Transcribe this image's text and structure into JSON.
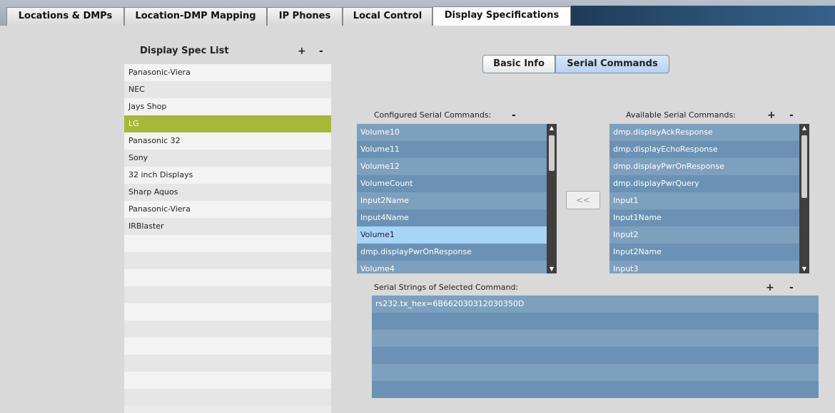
{
  "tabs": [
    {
      "label": "Locations & DMPs",
      "active": false
    },
    {
      "label": "Location-DMP Mapping",
      "active": false
    },
    {
      "label": "IP Phones",
      "active": false
    },
    {
      "label": "Local Control",
      "active": false
    },
    {
      "label": "Display Specifications",
      "active": true
    }
  ],
  "spec_list": {
    "title": "Display Spec List",
    "add_label": "+",
    "remove_label": "-",
    "items": [
      "Panasonic-Viera",
      "NEC",
      "Jays Shop",
      "LG",
      "Panasonic 32",
      "Sony",
      "32 inch Displays",
      "Sharp Aquos",
      "Panasonic-Viera",
      "IRBlaster"
    ],
    "selected": "LG"
  },
  "mode_buttons": {
    "basic_info": "Basic Info",
    "serial_commands": "Serial Commands",
    "active": "Serial Commands"
  },
  "configured": {
    "label": "Configured Serial Commands:",
    "remove_label": "-",
    "items": [
      "Volume10",
      "Volume11",
      "Volume12",
      "VolumeCount",
      "Input2Name",
      "Input4Name",
      "Volume1",
      "dmp.displayPwrOnResponse",
      "Volume4"
    ],
    "selected": "Volume1"
  },
  "available": {
    "label": "Available Serial Commands:",
    "add_label": "+",
    "remove_label": "-",
    "items": [
      "dmp.displayAckResponse",
      "dmp.displayEchoResponse",
      "dmp.displayPwrOnResponse",
      "dmp.displayPwrQuery",
      "Input1",
      "Input1Name",
      "Input2",
      "Input2Name",
      "Input3"
    ]
  },
  "transfer_button": "<<",
  "serial_strings": {
    "label": "Serial Strings of Selected Command:",
    "add_label": "+",
    "remove_label": "-",
    "items": [
      "rs232.tx_hex=6B662030312030350D",
      "",
      "",
      "",
      "",
      ""
    ]
  }
}
